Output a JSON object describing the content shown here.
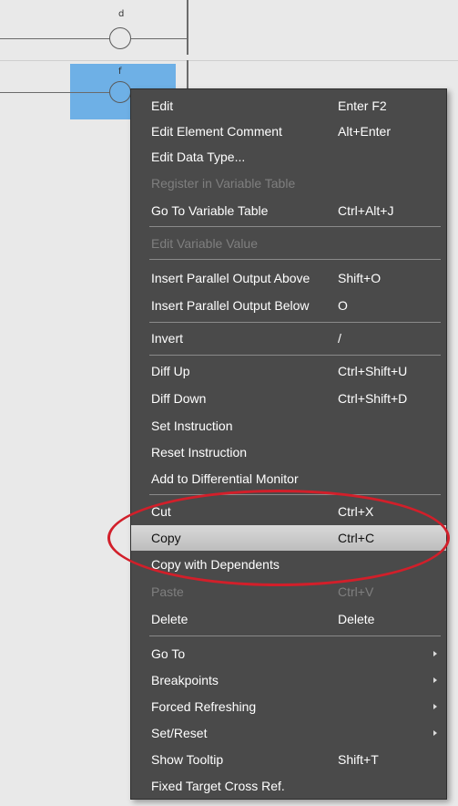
{
  "ladder": {
    "coil_top_label": "d",
    "coil_bottom_label": "f"
  },
  "menu": {
    "items": [
      {
        "label": "Edit",
        "shortcut": "Enter F2"
      },
      {
        "label": "Edit Element Comment",
        "shortcut": "Alt+Enter"
      },
      {
        "label": "Edit Data Type...",
        "shortcut": ""
      },
      {
        "label": "Register in Variable Table",
        "shortcut": "",
        "disabled": true
      },
      {
        "label": "Go To Variable Table",
        "shortcut": "Ctrl+Alt+J"
      },
      {
        "label": "Edit Variable Value",
        "shortcut": "",
        "disabled": true
      },
      {
        "label": "Insert Parallel Output Above",
        "shortcut": "Shift+O"
      },
      {
        "label": "Insert Parallel Output Below",
        "shortcut": "O"
      },
      {
        "label": "Invert",
        "shortcut": "/"
      },
      {
        "label": "Diff Up",
        "shortcut": "Ctrl+Shift+U"
      },
      {
        "label": "Diff Down",
        "shortcut": "Ctrl+Shift+D"
      },
      {
        "label": "Set Instruction",
        "shortcut": ""
      },
      {
        "label": "Reset Instruction",
        "shortcut": ""
      },
      {
        "label": "Add to Differential Monitor",
        "shortcut": ""
      },
      {
        "label": "Cut",
        "shortcut": "Ctrl+X"
      },
      {
        "label": "Copy",
        "shortcut": "Ctrl+C",
        "highlight": true
      },
      {
        "label": "Copy with Dependents",
        "shortcut": ""
      },
      {
        "label": "Paste",
        "shortcut": "Ctrl+V",
        "disabled": true
      },
      {
        "label": "Delete",
        "shortcut": "Delete"
      },
      {
        "label": "Go To",
        "shortcut": "",
        "submenu": true
      },
      {
        "label": "Breakpoints",
        "shortcut": "",
        "submenu": true
      },
      {
        "label": "Forced Refreshing",
        "shortcut": "",
        "submenu": true
      },
      {
        "label": "Set/Reset",
        "shortcut": "",
        "submenu": true
      },
      {
        "label": "Show Tooltip",
        "shortcut": "Shift+T"
      },
      {
        "label": "Fixed Target Cross Ref.",
        "shortcut": ""
      }
    ]
  },
  "colors": {
    "menu_bg": "#4a4a4a",
    "selection": "#6eb0e6",
    "annotation": "#d21f2a",
    "highlight": "#c9c9c9"
  }
}
